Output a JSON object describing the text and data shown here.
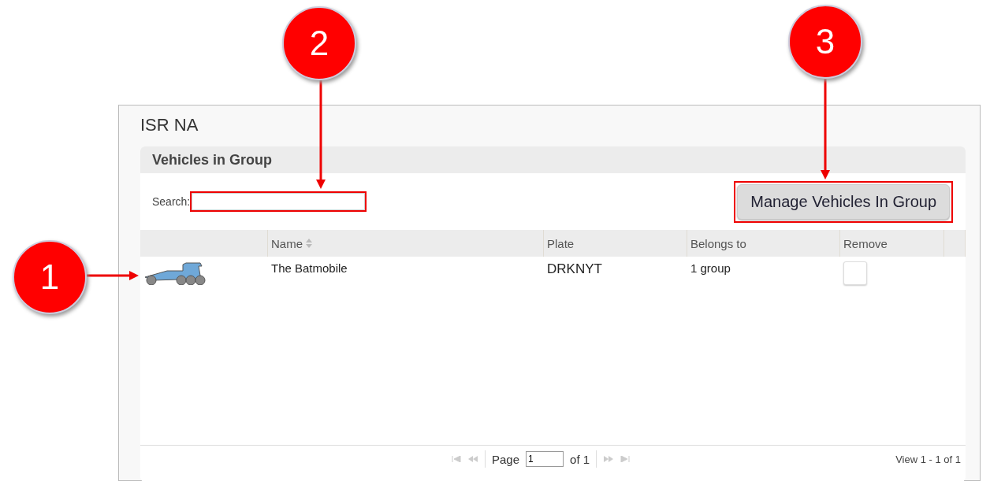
{
  "window": {
    "title": "ISR NA"
  },
  "section": {
    "title": "Vehicles in Group"
  },
  "search": {
    "label": "Search:",
    "highlighted": true
  },
  "manage_button": {
    "label": "Manage Vehicles In Group",
    "highlighted": true
  },
  "table": {
    "columns": [
      {
        "label": "Name",
        "sortable": true
      },
      {
        "label": "Plate",
        "sortable": false
      },
      {
        "label": "Belongs to",
        "sortable": false
      },
      {
        "label": "Remove",
        "sortable": false
      }
    ],
    "rows": [
      {
        "name": "The Batmobile",
        "plate": "DRKNYT",
        "belongs_to": "1 group",
        "remove_checked": false
      }
    ]
  },
  "pager": {
    "page_label": "Page",
    "page_value": "1",
    "of": "of 1",
    "view": "View 1 - 1 of 1"
  },
  "callouts": [
    {
      "label": "1"
    },
    {
      "label": "2"
    },
    {
      "label": "3"
    }
  ]
}
